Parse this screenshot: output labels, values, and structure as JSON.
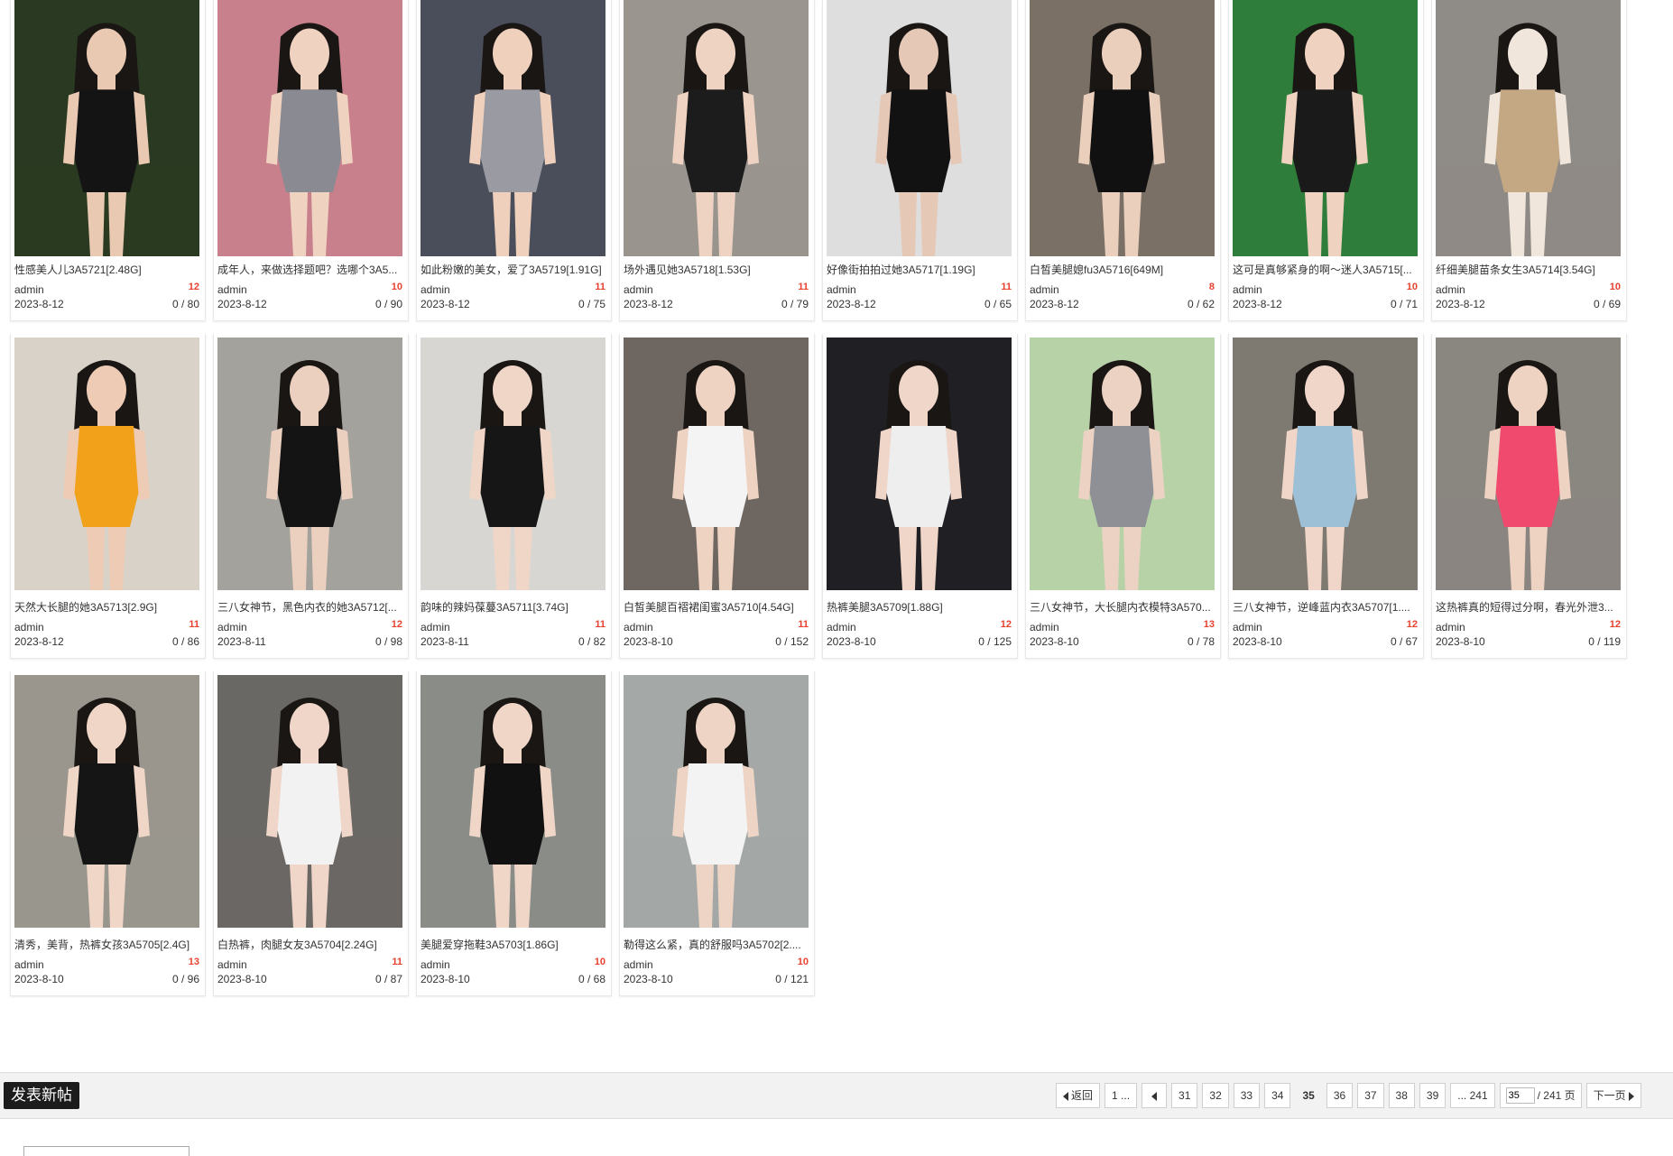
{
  "posts": [
    {
      "title": "性感美人儿3A5721[2.48G]",
      "author": "admin",
      "count": "12",
      "date": "2023-8-12",
      "stats": "0 / 80",
      "palette": [
        "#2a3a22",
        "#141414",
        "#e9c9b2"
      ]
    },
    {
      "title": "成年人，来做选择题吧？选哪个3A5...",
      "author": "admin",
      "count": "10",
      "date": "2023-8-12",
      "stats": "0 / 90",
      "palette": [
        "#c8808c",
        "#8a8a92",
        "#f0d2c0"
      ]
    },
    {
      "title": "如此粉嫩的美女，爱了3A5719[1.91G]",
      "author": "admin",
      "count": "11",
      "date": "2023-8-12",
      "stats": "0 / 75",
      "palette": [
        "#4a4e5a",
        "#9a9aa2",
        "#efd0bd"
      ]
    },
    {
      "title": "场外遇见她3A5718[1.53G]",
      "author": "admin",
      "count": "11",
      "date": "2023-8-12",
      "stats": "0 / 79",
      "palette": [
        "#9a958e",
        "#1c1c1c",
        "#eed3c2"
      ]
    },
    {
      "title": "好像街拍拍过她3A5717[1.19G]",
      "author": "admin",
      "count": "11",
      "date": "2023-8-12",
      "stats": "0 / 65",
      "palette": [
        "#dedede",
        "#121212",
        "#e6c8b6"
      ]
    },
    {
      "title": "白皙美腿媳fu3A5716[649M]",
      "author": "admin",
      "count": "8",
      "date": "2023-8-12",
      "stats": "0 / 62",
      "palette": [
        "#7a7066",
        "#111111",
        "#ebcfbd"
      ]
    },
    {
      "title": "这可是真够紧身的啊～迷人3A5715[...",
      "author": "admin",
      "count": "10",
      "date": "2023-8-12",
      "stats": "0 / 71",
      "palette": [
        "#2f7d3a",
        "#1a1a1a",
        "#efd2c0"
      ]
    },
    {
      "title": "纤细美腿苗条女生3A5714[3.54G]",
      "author": "admin",
      "count": "10",
      "date": "2023-8-12",
      "stats": "0 / 69",
      "palette": [
        "#8f8b86",
        "#c4a884",
        "#f1e6dc"
      ]
    },
    {
      "title": "天然大长腿的她3A5713[2.9G]",
      "author": "admin",
      "count": "11",
      "date": "2023-8-12",
      "stats": "0 / 86",
      "palette": [
        "#d9d2c8",
        "#f2a21a",
        "#eecbb4"
      ]
    },
    {
      "title": "三八女神节，黑色内衣的她3A5712[...",
      "author": "admin",
      "count": "12",
      "date": "2023-8-11",
      "stats": "0 / 98",
      "palette": [
        "#a4a29c",
        "#141414",
        "#ecd0bf"
      ]
    },
    {
      "title": "韵味的辣妈葆蔓3A5711[3.74G]",
      "author": "admin",
      "count": "11",
      "date": "2023-8-11",
      "stats": "0 / 82",
      "palette": [
        "#d8d6d2",
        "#161616",
        "#efd6c6"
      ]
    },
    {
      "title": "白皙美腿百褶裙闺蜜3A5710[4.54G]",
      "author": "admin",
      "count": "11",
      "date": "2023-8-10",
      "stats": "0 / 152",
      "palette": [
        "#6e6660",
        "#f4f4f4",
        "#efd3c2"
      ]
    },
    {
      "title": "热裤美腿3A5709[1.88G]",
      "author": "admin",
      "count": "12",
      "date": "2023-8-10",
      "stats": "0 / 125",
      "palette": [
        "#1f1f24",
        "#eeeeee",
        "#efd6c8"
      ]
    },
    {
      "title": "三八女神节，大长腿内衣模特3A570...",
      "author": "admin",
      "count": "13",
      "date": "2023-8-10",
      "stats": "0 / 78",
      "palette": [
        "#b8d2a8",
        "#8e9096",
        "#ecd2c2"
      ]
    },
    {
      "title": "三八女神节，逆峰蓝内衣3A5707[1....",
      "author": "admin",
      "count": "12",
      "date": "2023-8-10",
      "stats": "0 / 67",
      "palette": [
        "#7e7a72",
        "#9ec0d6",
        "#efd6c8"
      ]
    },
    {
      "title": "这热裤真的短得过分啊，春光外泄3...",
      "author": "admin",
      "count": "12",
      "date": "2023-8-10",
      "stats": "0 / 119",
      "palette": [
        "#8a8680",
        "#f04a6e",
        "#eed2c2"
      ]
    },
    {
      "title": "清秀，美背，热裤女孩3A5705[2.4G]",
      "author": "admin",
      "count": "13",
      "date": "2023-8-10",
      "stats": "0 / 96",
      "palette": [
        "#9a968e",
        "#151515",
        "#efd6c6"
      ]
    },
    {
      "title": "白热裤，肉腿女友3A5704[2.24G]",
      "author": "admin",
      "count": "11",
      "date": "2023-8-10",
      "stats": "0 / 87",
      "palette": [
        "#6a6864",
        "#f2f2f2",
        "#efd6c8"
      ]
    },
    {
      "title": "美腿爱穿拖鞋3A5703[1.86G]",
      "author": "admin",
      "count": "10",
      "date": "2023-8-10",
      "stats": "0 / 68",
      "palette": [
        "#8a8c88",
        "#111111",
        "#efd6c6"
      ]
    },
    {
      "title": "勒得这么紧，真的舒服吗3A5702[2....",
      "author": "admin",
      "count": "10",
      "date": "2023-8-10",
      "stats": "0 / 121",
      "palette": [
        "#a4a8a6",
        "#f3f3f3",
        "#eed4c4"
      ]
    }
  ],
  "new_post_label": "发表新帖",
  "pagination": {
    "back": "返回",
    "first": "1 ...",
    "pages": [
      "31",
      "32",
      "33",
      "34",
      "35",
      "36",
      "37",
      "38",
      "39"
    ],
    "current": "35",
    "last": "... 241",
    "jump_value": "35",
    "total": "/ 241 页",
    "next": "下一页"
  }
}
